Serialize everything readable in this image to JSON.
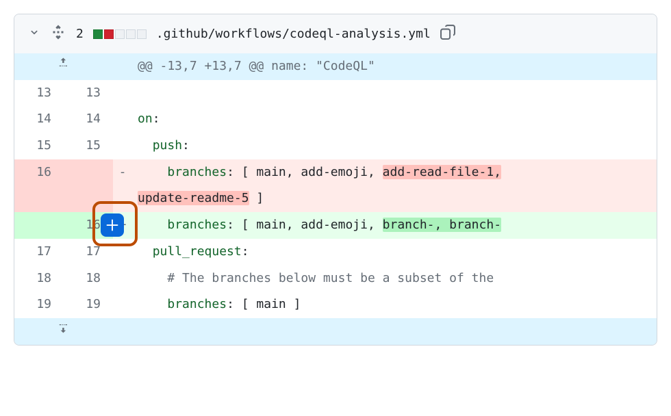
{
  "file": {
    "count": "2",
    "path": ".github/workflows/codeql-analysis.yml"
  },
  "hunk": {
    "header": "@@ -13,7 +13,7 @@ name: \"CodeQL\""
  },
  "lines": {
    "r13_old": "13",
    "r13_new": "13",
    "r13_code": "",
    "r14_old": "14",
    "r14_new": "14",
    "r14_kw": "on",
    "r14_rest": ":",
    "r15_old": "15",
    "r15_new": "15",
    "r15_kw": "push",
    "r15_rest": ":",
    "r16d_old": "16",
    "r16d_kw": "branches",
    "r16d_p1": ": [ main, add-emoji, ",
    "r16d_hl": "add-read-file-1,",
    "r16d_wrap_hl": "update-readme-5",
    "r16d_wrap_rest": " ]",
    "r16a_new": "16",
    "r16a_kw": "branches",
    "r16a_p1": ": [ main, add-emoji, ",
    "r16a_hl": "branch-, branch-",
    "r17_old": "17",
    "r17_new": "17",
    "r17_kw": "pull_request",
    "r17_rest": ":",
    "r18_old": "18",
    "r18_new": "18",
    "r18_comment": "# The branches below must be a subset of the ",
    "r19_old": "19",
    "r19_new": "19",
    "r19_kw": "branches",
    "r19_rest": ": [ main ]"
  }
}
